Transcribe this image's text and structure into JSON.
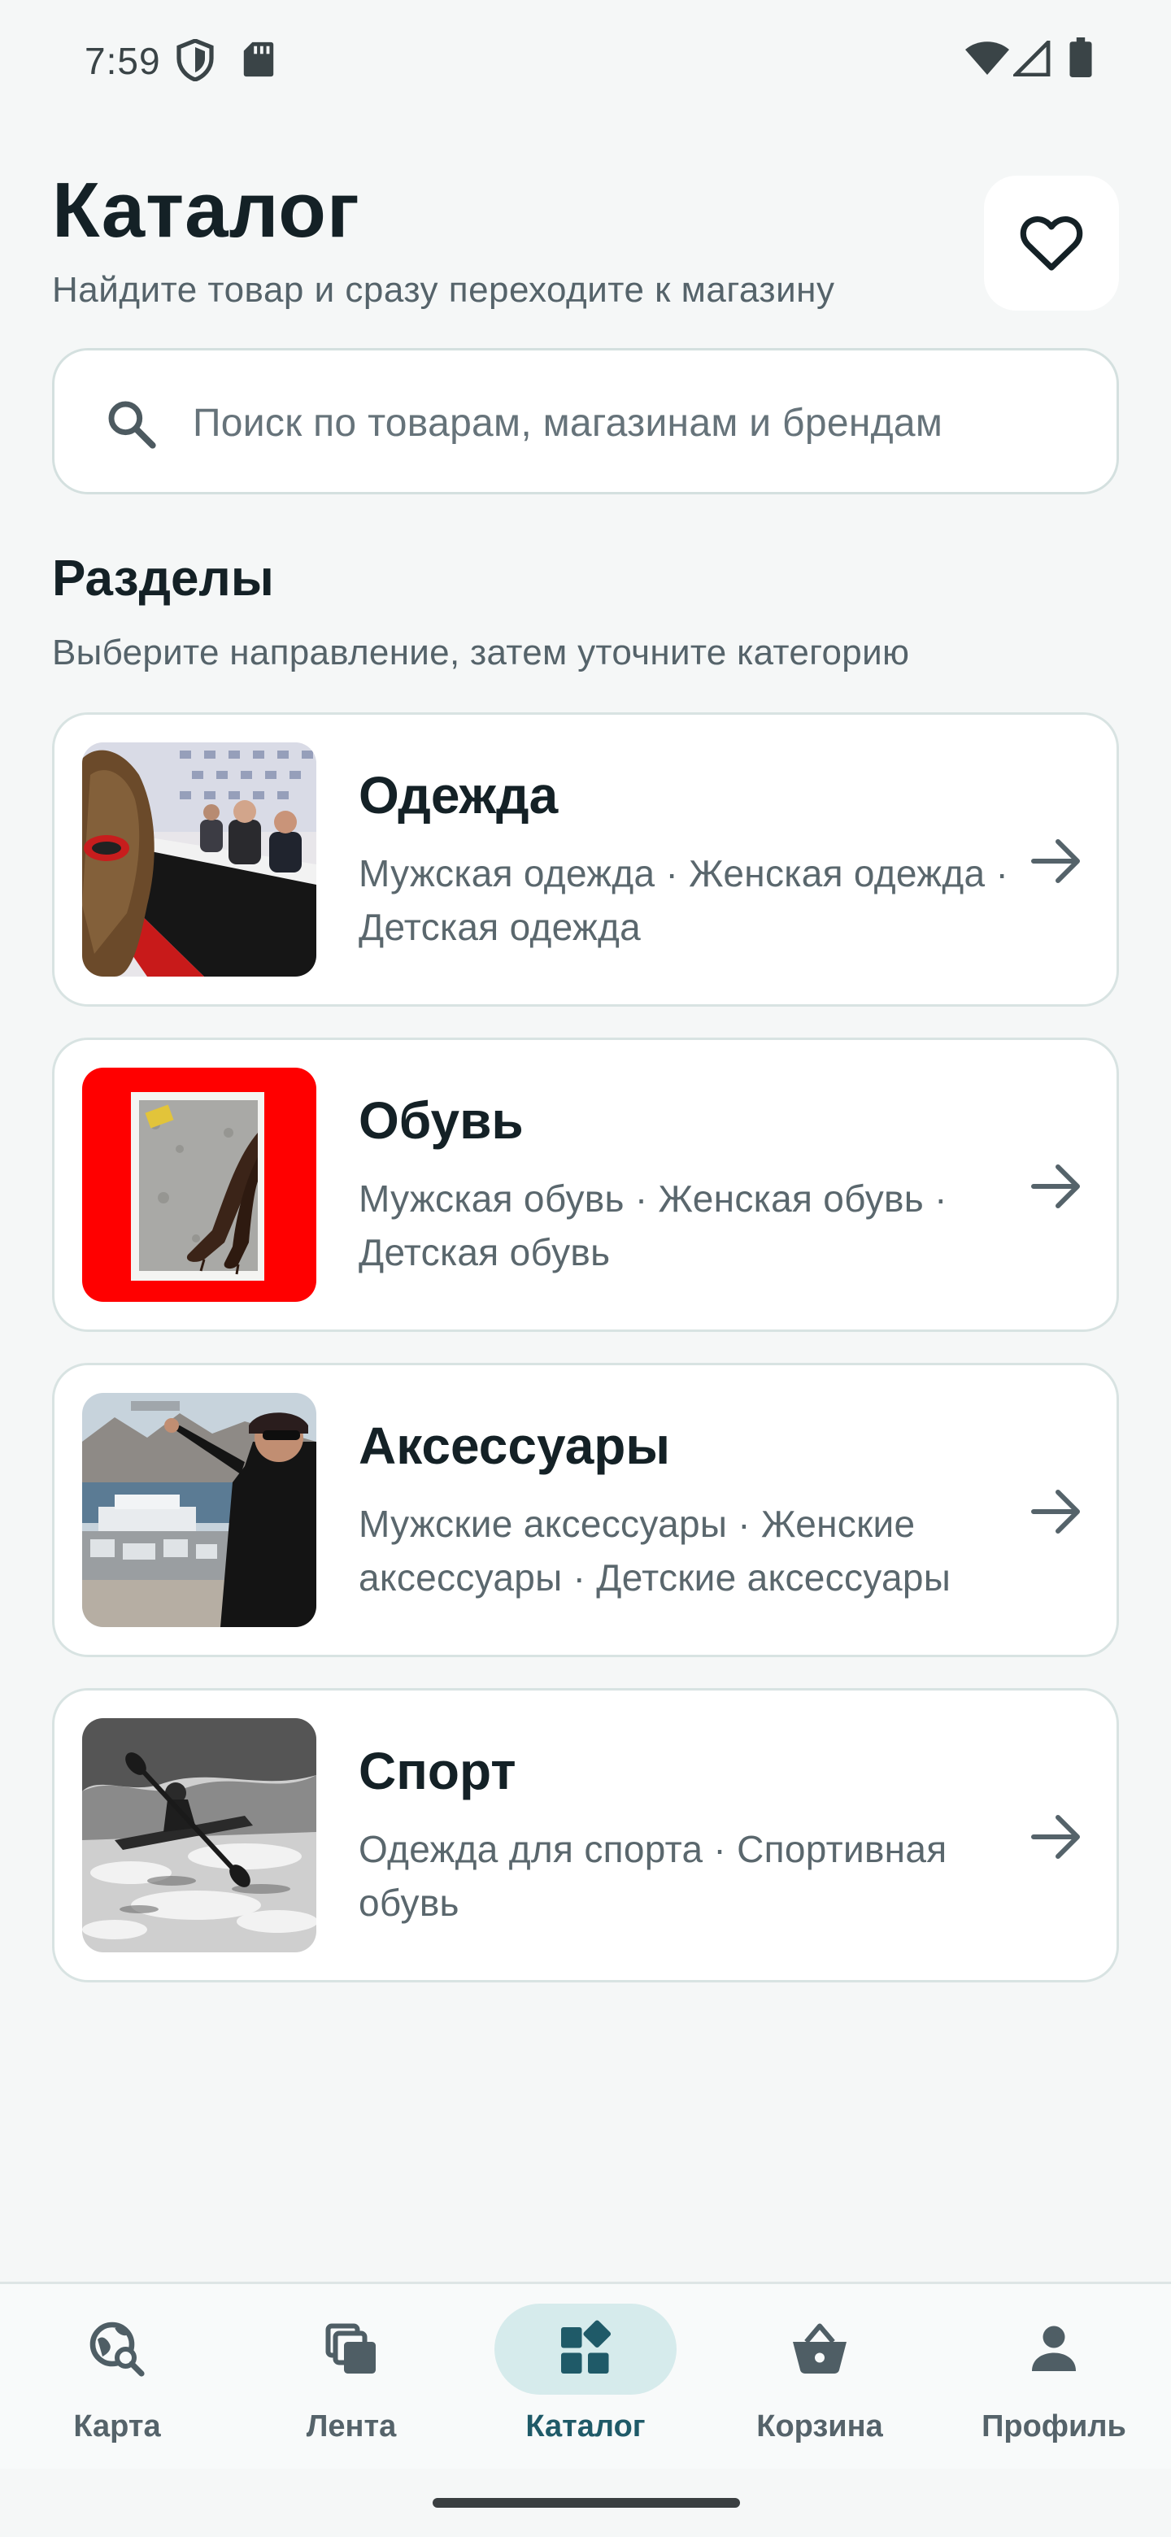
{
  "status_bar": {
    "time": "7:59",
    "icons": [
      "shield-icon",
      "sd-card-icon",
      "wifi-icon",
      "signal-icon",
      "battery-icon"
    ]
  },
  "header": {
    "title": "Каталог",
    "subtitle": "Найдите товар и сразу переходите к магазину",
    "favorites_icon": "heart-icon"
  },
  "search": {
    "placeholder": "Поиск по товарам, магазинам и брендам",
    "icon": "search-icon"
  },
  "sections": {
    "title": "Разделы",
    "subtitle": "Выберите направление, затем уточните категорию",
    "items": [
      {
        "title": "Одежда",
        "description": "Мужская одежда · Женская одежда · Детская одежда",
        "thumb": "event-photo"
      },
      {
        "title": "Обувь",
        "description": "Мужская обувь · Женская обувь · Детская обувь",
        "thumb": "boots-photo"
      },
      {
        "title": "Аксессуары",
        "description": "Мужские аксессуары · Женские аксессуары · Детские аксессуары",
        "thumb": "harbor-photo"
      },
      {
        "title": "Спорт",
        "description": "Одежда для спорта · Спортивная обувь",
        "thumb": "kayak-photo"
      }
    ]
  },
  "bottom_nav": {
    "active_index": 2,
    "items": [
      {
        "label": "Карта",
        "icon": "map-search-icon"
      },
      {
        "label": "Лента",
        "icon": "feed-icon"
      },
      {
        "label": "Каталог",
        "icon": "catalog-icon"
      },
      {
        "label": "Корзина",
        "icon": "basket-icon"
      },
      {
        "label": "Профиль",
        "icon": "profile-icon"
      }
    ]
  },
  "colors": {
    "background": "#f5f7f7",
    "accent": "#1f5a68",
    "active_pill": "#d6ebec",
    "text_primary": "#142126",
    "text_secondary": "#55636a"
  }
}
